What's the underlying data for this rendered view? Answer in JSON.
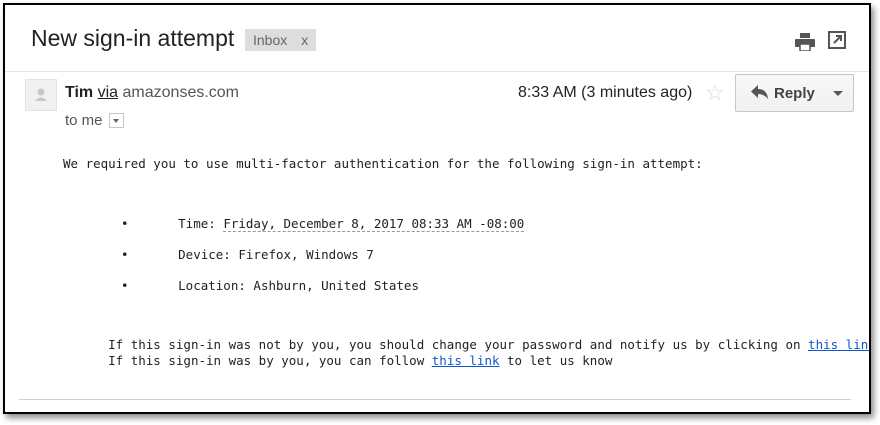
{
  "email": {
    "subject": "New sign-in attempt",
    "label": {
      "name": "Inbox",
      "remove": "x"
    },
    "sender_name": "Tim",
    "via_word": "via",
    "sender_domain": "amazonses.com",
    "recipient": "to me",
    "time": "8:33 AM (3 minutes ago)",
    "reply_label": "Reply"
  },
  "body": {
    "intro": "We required you to use multi-factor authentication for the following sign-in attempt:",
    "details": {
      "time_label": "Time: ",
      "time_value": "Friday, December 8, 2017 08:33 AM -08:00",
      "device": "Device: Firefox, Windows 7",
      "location": "Location: Ashburn, United States"
    },
    "not_you_text": "If this sign-in was not by you, you should change your password and notify us by clicking on ",
    "not_you_link": "this link",
    "by_you_text": "If this sign-in was by you, you can follow ",
    "by_you_link": "this link",
    "by_you_tail": " to let us know"
  },
  "icons": [
    "print-icon",
    "popout-icon",
    "avatar-icon",
    "star-icon",
    "reply-arrow-icon",
    "chevron-down-icon"
  ]
}
